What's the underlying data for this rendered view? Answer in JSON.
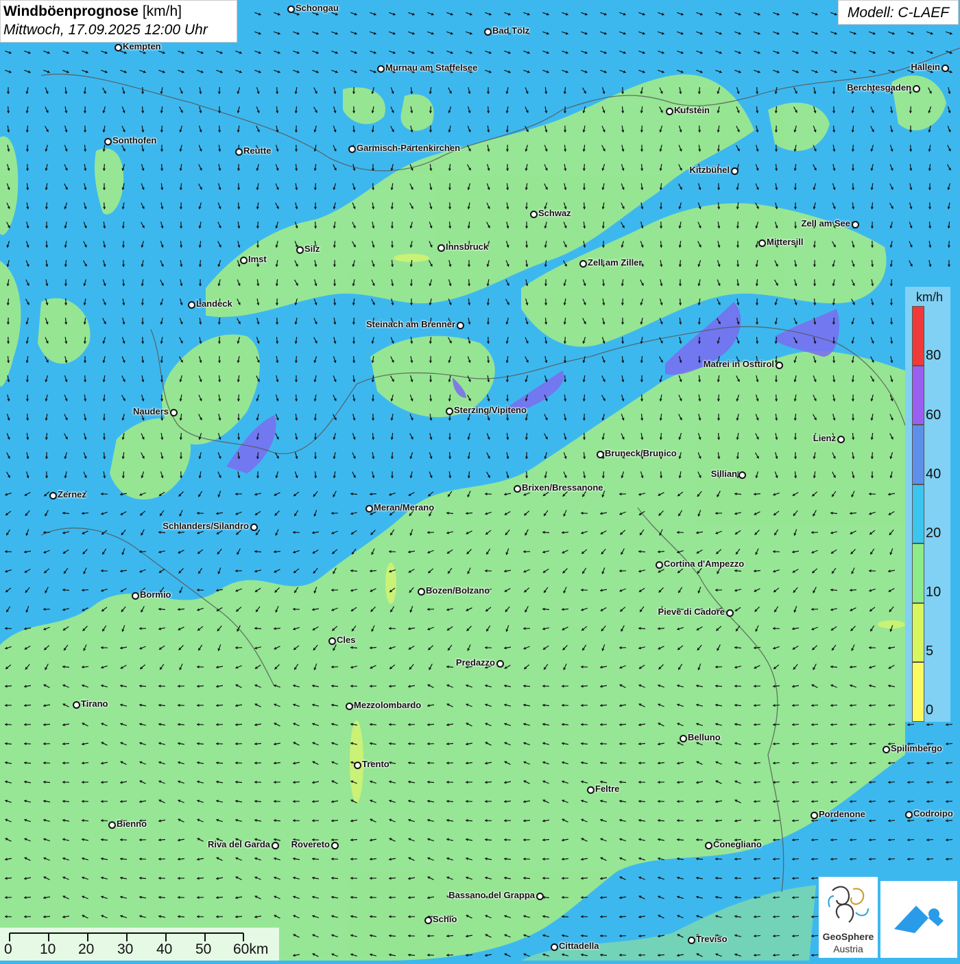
{
  "title": {
    "main": "Windböenprognose",
    "unit": "[km/h]",
    "datetime": "Mittwoch, 17.09.2025 12:00 Uhr"
  },
  "model_label": "Modell: C-LAEF",
  "legend": {
    "unit": "km/h",
    "labels": [
      "80",
      "60",
      "40",
      "20",
      "10",
      "5",
      "0"
    ],
    "colors": [
      "#f03a3a",
      "#9a5ff0",
      "#5e8fea",
      "#3cc6ef",
      "#8eec88",
      "#d8f75f",
      "#fbfb61"
    ]
  },
  "scale": {
    "labels": [
      "0",
      "10",
      "20",
      "30",
      "40",
      "50",
      "60km"
    ]
  },
  "logo": {
    "name": "GeoSphere",
    "sub": "Austria"
  },
  "colors": {
    "calm_green": "#9be88f",
    "wind_blue": "#3db8ef",
    "strong_purple": "#7a6cf0"
  },
  "cities": [
    {
      "name": "Schongau"
    },
    {
      "name": "Bad Tölz"
    },
    {
      "name": "Kempten"
    },
    {
      "name": "Murnau am Staffelsee"
    },
    {
      "name": "Hallein"
    },
    {
      "name": "Berchtesgaden"
    },
    {
      "name": "Kufstein"
    },
    {
      "name": "Sonthofen"
    },
    {
      "name": "Reutte"
    },
    {
      "name": "Garmisch-Partenkirchen"
    },
    {
      "name": "Kitzbühel"
    },
    {
      "name": "Schwaz"
    },
    {
      "name": "Zell am See"
    },
    {
      "name": "Mittersill"
    },
    {
      "name": "Silz"
    },
    {
      "name": "Innsbruck"
    },
    {
      "name": "Imst"
    },
    {
      "name": "Zell am Ziller"
    },
    {
      "name": "Landeck"
    },
    {
      "name": "Steinach am Brenner"
    },
    {
      "name": "Matrei in Osttirol"
    },
    {
      "name": "Nauders"
    },
    {
      "name": "Sterzing/Vipiteno"
    },
    {
      "name": "Lienz"
    },
    {
      "name": "Bruneck/Brunico"
    },
    {
      "name": "Sillian"
    },
    {
      "name": "Brixen/Bressanone"
    },
    {
      "name": "Zernez"
    },
    {
      "name": "Meran/Merano"
    },
    {
      "name": "Schlanders/Silandro"
    },
    {
      "name": "Cortina d'Ampezzo"
    },
    {
      "name": "Bozen/Bolzano"
    },
    {
      "name": "Bormio"
    },
    {
      "name": "Pieve di Cadore"
    },
    {
      "name": "Cles"
    },
    {
      "name": "Predazzo"
    },
    {
      "name": "Tirano"
    },
    {
      "name": "Mezzolombardo"
    },
    {
      "name": "Belluno"
    },
    {
      "name": "Spilimbergo"
    },
    {
      "name": "Trento"
    },
    {
      "name": "Feltre"
    },
    {
      "name": "Pordenone"
    },
    {
      "name": "Codroipo"
    },
    {
      "name": "Bienno"
    },
    {
      "name": "Riva del Garda"
    },
    {
      "name": "Rovereto"
    },
    {
      "name": "Conegliano"
    },
    {
      "name": "Bassano del Grappa"
    },
    {
      "name": "Schio"
    },
    {
      "name": "Treviso"
    },
    {
      "name": "Cittadella"
    }
  ]
}
